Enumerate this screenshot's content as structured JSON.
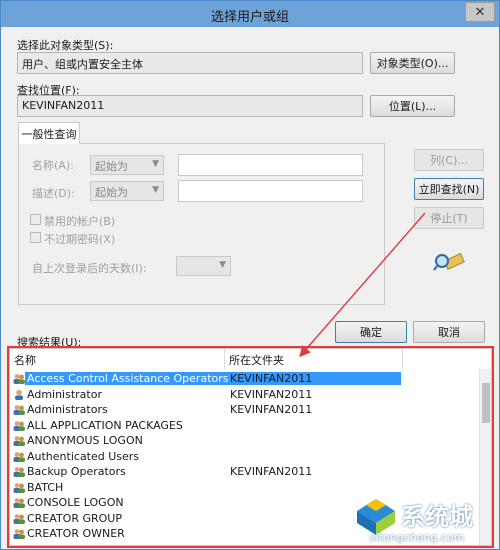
{
  "window": {
    "title": "选择用户或组",
    "close_glyph": "✕"
  },
  "object_type": {
    "label": "选择此对象类型(S):",
    "value": "用户、组或内置安全主体",
    "button": "对象类型(O)..."
  },
  "location": {
    "label": "查找位置(F):",
    "value": "KEVINFAN2011",
    "button": "位置(L)..."
  },
  "query": {
    "tab": "一般性查询",
    "name_label": "名称(A):",
    "name_mode": "起始为",
    "desc_label": "描述(D):",
    "desc_mode": "起始为",
    "disabled_accounts": "禁用的帐户(B)",
    "non_expiring": "不过期密码(X)",
    "days_since_logon": "自上次登录后的天数(I):"
  },
  "side_buttons": {
    "columns": "列(C)...",
    "find_now": "立即查找(N)",
    "stop": "停止(T)"
  },
  "dialog_buttons": {
    "ok": "确定",
    "cancel": "取消"
  },
  "results": {
    "label": "搜索结果(U):",
    "columns": [
      "名称",
      "所在文件夹"
    ],
    "rows": [
      {
        "name": "Access Control Assistance Operators",
        "folder": "KEVINFAN2011",
        "icon": "group-icon",
        "selected": true
      },
      {
        "name": "Administrator",
        "folder": "KEVINFAN2011",
        "icon": "user-icon"
      },
      {
        "name": "Administrators",
        "folder": "KEVINFAN2011",
        "icon": "group-icon"
      },
      {
        "name": "ALL APPLICATION PACKAGES",
        "folder": "",
        "icon": "group-icon"
      },
      {
        "name": "ANONYMOUS LOGON",
        "folder": "",
        "icon": "group-icon"
      },
      {
        "name": "Authenticated Users",
        "folder": "",
        "icon": "group-icon"
      },
      {
        "name": "Backup Operators",
        "folder": "KEVINFAN2011",
        "icon": "group-icon"
      },
      {
        "name": "BATCH",
        "folder": "",
        "icon": "group-icon"
      },
      {
        "name": "CONSOLE LOGON",
        "folder": "",
        "icon": "group-icon"
      },
      {
        "name": "CREATOR GROUP",
        "folder": "",
        "icon": "group-icon"
      },
      {
        "name": "CREATOR OWNER",
        "folder": "",
        "icon": "group-icon"
      }
    ]
  },
  "watermark": {
    "text": "系统城",
    "url": "xitongcheng.com"
  },
  "colors": {
    "titlebar": "#6ea3d9",
    "selection": "#3399ff",
    "annotation": "#e23b3b"
  }
}
